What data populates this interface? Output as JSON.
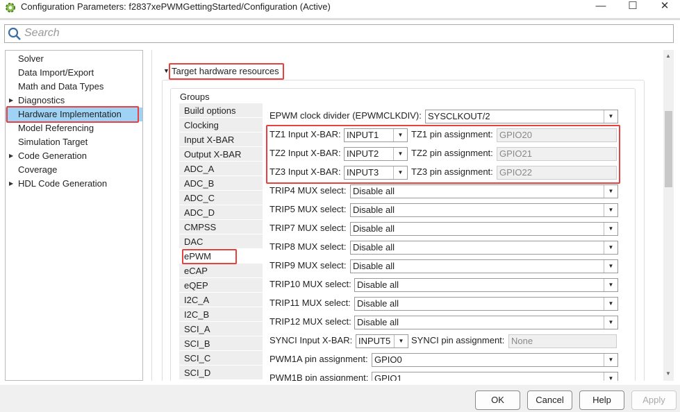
{
  "window": {
    "title": "Configuration Parameters: f2837xePWMGettingStarted/Configuration (Active)",
    "minimize": "—",
    "maximize": "☐",
    "close": "✕"
  },
  "search": {
    "placeholder": "Search"
  },
  "tree": [
    {
      "label": "Solver",
      "expandable": false
    },
    {
      "label": "Data Import/Export",
      "expandable": false
    },
    {
      "label": "Math and Data Types",
      "expandable": false
    },
    {
      "label": "Diagnostics",
      "expandable": true
    },
    {
      "label": "Hardware Implementation",
      "expandable": false,
      "selected": true
    },
    {
      "label": "Model Referencing",
      "expandable": false
    },
    {
      "label": "Simulation Target",
      "expandable": false
    },
    {
      "label": "Code Generation",
      "expandable": true
    },
    {
      "label": "Coverage",
      "expandable": false
    },
    {
      "label": "HDL Code Generation",
      "expandable": true
    }
  ],
  "section": {
    "title": "Target hardware resources",
    "groups_label": "Groups"
  },
  "groups": [
    "Build options",
    "Clocking",
    "Input X-BAR",
    "Output X-BAR",
    "ADC_A",
    "ADC_B",
    "ADC_C",
    "ADC_D",
    "CMPSS",
    "DAC",
    "ePWM",
    "eCAP",
    "eQEP",
    "I2C_A",
    "I2C_B",
    "SCI_A",
    "SCI_B",
    "SCI_C",
    "SCI_D"
  ],
  "selected_group": "ePWM",
  "params": {
    "clkdiv": {
      "label": "EPWM clock divider (EPWMCLKDIV):",
      "value": "SYSCLKOUT/2"
    },
    "tz": [
      {
        "label": "TZ1 Input X-BAR:",
        "value": "INPUT1",
        "pin_label": "TZ1 pin assignment:",
        "pin": "GPIO20"
      },
      {
        "label": "TZ2 Input X-BAR:",
        "value": "INPUT2",
        "pin_label": "TZ2 pin assignment:",
        "pin": "GPIO21"
      },
      {
        "label": "TZ3 Input X-BAR:",
        "value": "INPUT3",
        "pin_label": "TZ3 pin assignment:",
        "pin": "GPIO22"
      }
    ],
    "trip": [
      {
        "label": "TRIP4 MUX select:",
        "value": "Disable all"
      },
      {
        "label": "TRIP5 MUX select:",
        "value": "Disable all"
      },
      {
        "label": "TRIP7 MUX select:",
        "value": "Disable all"
      },
      {
        "label": "TRIP8 MUX select:",
        "value": "Disable all"
      },
      {
        "label": "TRIP9 MUX select:",
        "value": "Disable all"
      },
      {
        "label": "TRIP10 MUX select:",
        "value": "Disable all"
      },
      {
        "label": "TRIP11 MUX select:",
        "value": "Disable all"
      },
      {
        "label": "TRIP12 MUX select:",
        "value": "Disable all"
      }
    ],
    "synci": {
      "label": "SYNCI Input X-BAR:",
      "value": "INPUT5",
      "pin_label": "SYNCI pin assignment:",
      "pin": "None"
    },
    "pwm": [
      {
        "label": "PWM1A pin assignment:",
        "value": "GPIO0"
      },
      {
        "label": "PWM1B pin assignment:",
        "value": "GPIO1"
      }
    ]
  },
  "buttons": {
    "ok": "OK",
    "cancel": "Cancel",
    "help": "Help",
    "apply": "Apply"
  },
  "colors": {
    "highlight": "#e8403f",
    "selection": "#9fd3f5"
  }
}
